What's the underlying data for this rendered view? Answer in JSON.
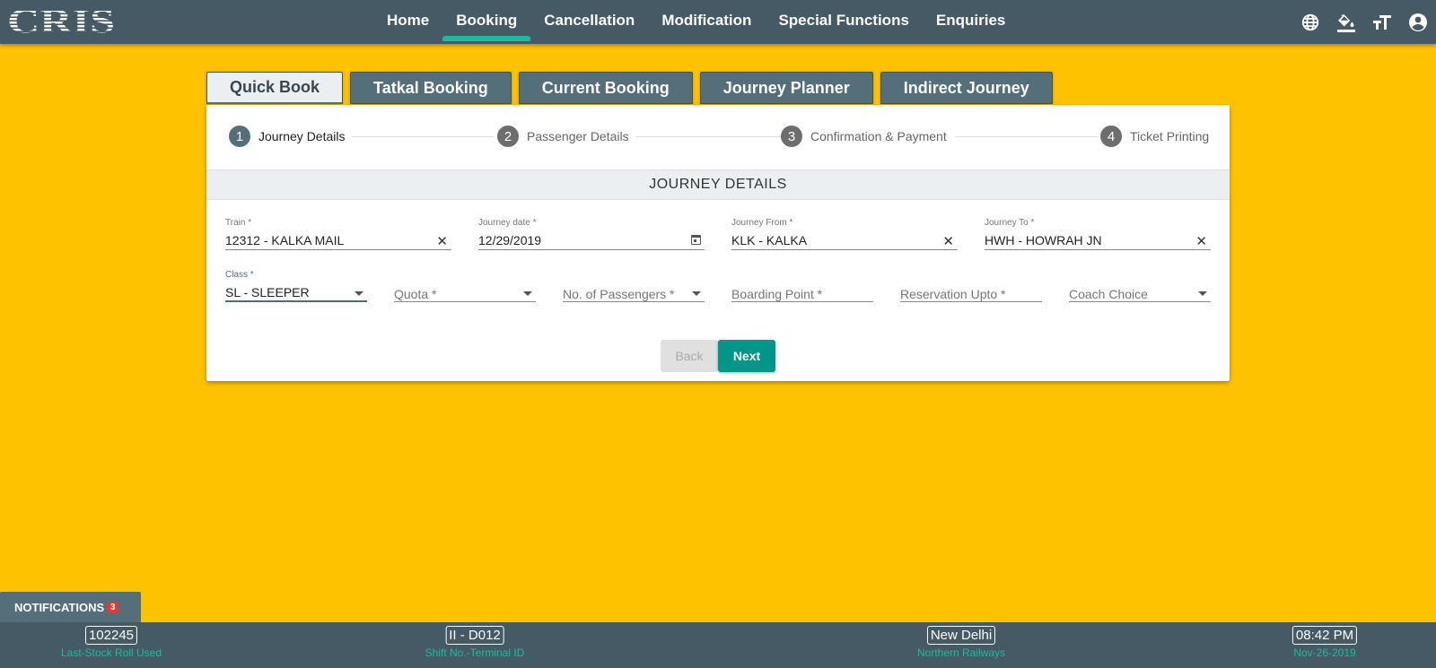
{
  "header": {
    "logo_text": "CRIS",
    "nav": [
      {
        "label": "Home"
      },
      {
        "label": "Booking"
      },
      {
        "label": "Cancellation"
      },
      {
        "label": "Modification"
      },
      {
        "label": "Special Functions"
      },
      {
        "label": "Enquiries"
      }
    ],
    "active_nav": "Booking",
    "icons": [
      "globe-icon",
      "paint-bucket-icon",
      "text-size-icon",
      "account-icon"
    ]
  },
  "tabs": [
    {
      "label": "Quick Book"
    },
    {
      "label": "Tatkal Booking"
    },
    {
      "label": "Current Booking"
    },
    {
      "label": "Journey Planner"
    },
    {
      "label": "Indirect Journey"
    }
  ],
  "active_tab": "Quick Book",
  "stepper": [
    {
      "num": "1",
      "label": "Journey Details"
    },
    {
      "num": "2",
      "label": "Passenger Details"
    },
    {
      "num": "3",
      "label": "Confirmation & Payment"
    },
    {
      "num": "4",
      "label": "Ticket Printing"
    }
  ],
  "section_title": "JOURNEY DETAILS",
  "form": {
    "train": {
      "label": "Train *",
      "value": "12312 - KALKA MAIL"
    },
    "journey_date": {
      "label": "Journey date *",
      "value": "12/29/2019"
    },
    "journey_from": {
      "label": "Journey From *",
      "value": "KLK - KALKA"
    },
    "journey_to": {
      "label": "Journey To *",
      "value": "HWH - HOWRAH JN"
    },
    "class": {
      "label": "Class *",
      "value": "SL - SLEEPER"
    },
    "quota": {
      "placeholder": "Quota *"
    },
    "passengers": {
      "placeholder": "No. of Passengers *"
    },
    "boarding": {
      "placeholder": "Boarding Point *"
    },
    "reservation_upto": {
      "placeholder": "Reservation Upto *"
    },
    "coach_choice": {
      "placeholder": "Coach Choice"
    }
  },
  "buttons": {
    "back": "Back",
    "next": "Next"
  },
  "notifications": {
    "label": "NOTIFICATIONS",
    "count": "3"
  },
  "footer": [
    {
      "value": "102245",
      "caption": "Last-Stock Roll Used"
    },
    {
      "value": "II - D012",
      "caption": "Shift No.-Terminal ID"
    },
    {
      "value": "New Delhi",
      "caption": "Northern Railways"
    },
    {
      "value": "08:42 PM",
      "caption": "Nov-26-2019"
    }
  ],
  "colors": {
    "background": "#ffc200",
    "header": "#455a64",
    "accent": "#009688",
    "active_underline": "#1abc9c"
  }
}
